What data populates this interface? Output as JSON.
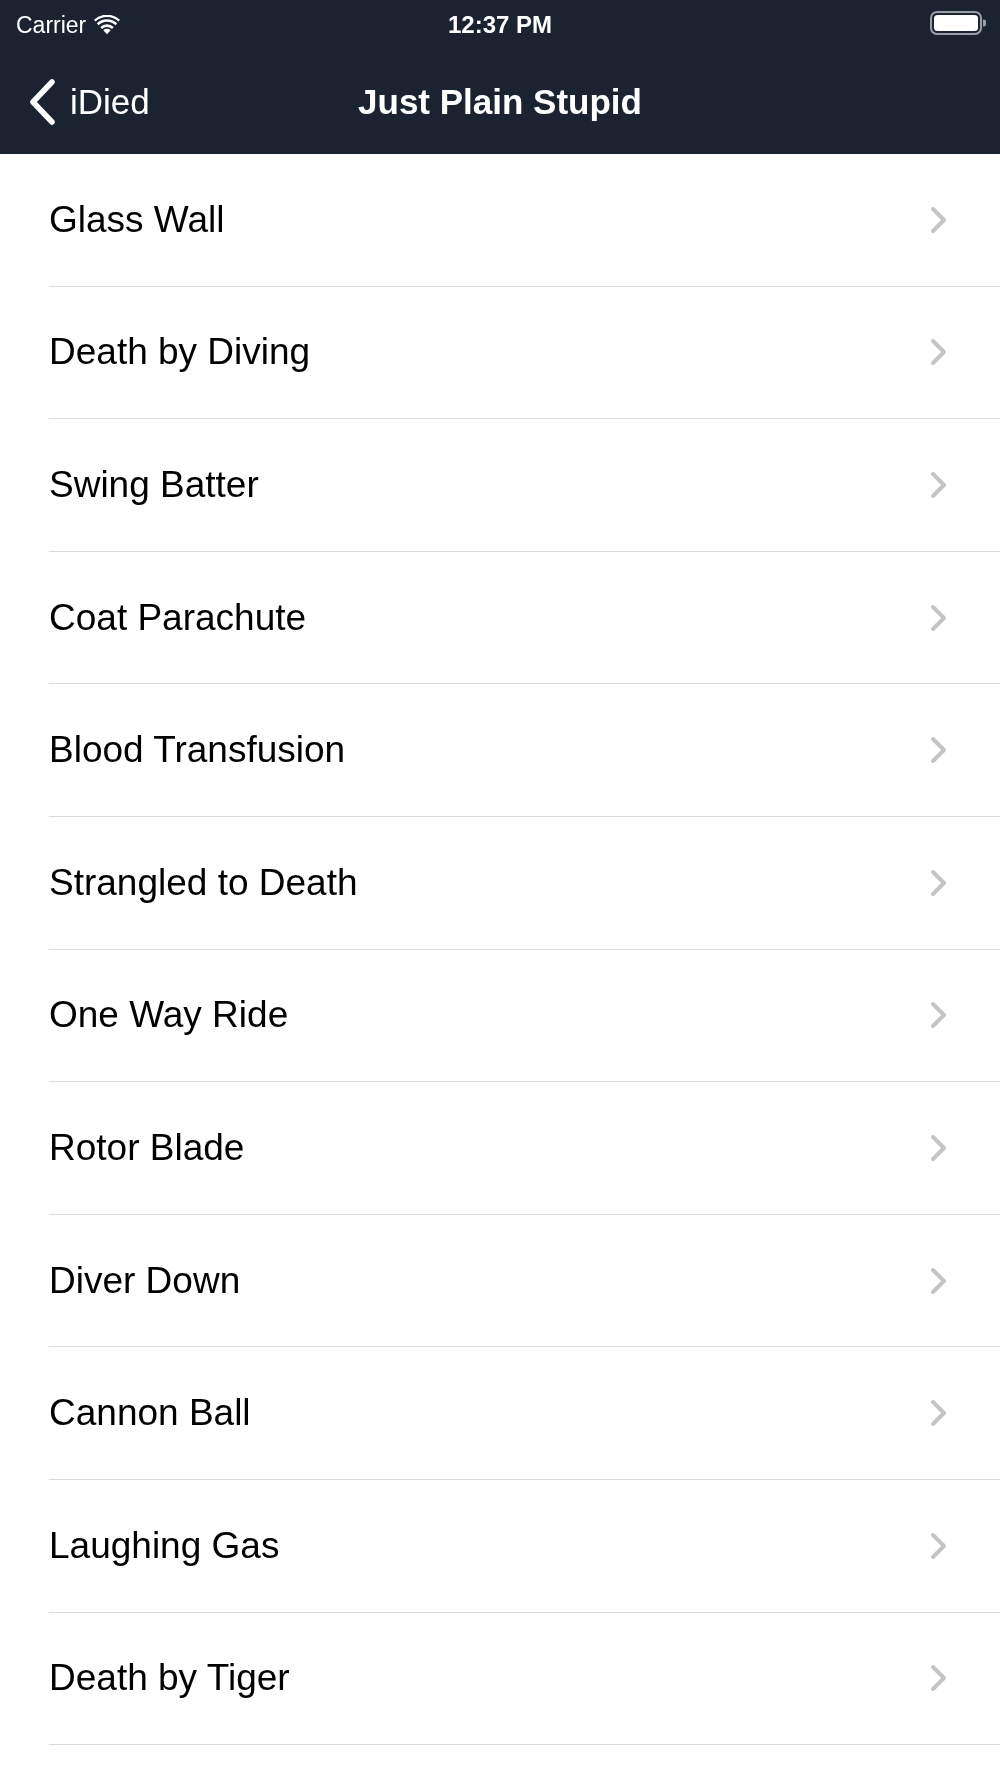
{
  "status_bar": {
    "carrier": "Carrier",
    "time": "12:37 PM"
  },
  "nav_bar": {
    "back_label": "iDied",
    "title": "Just Plain Stupid"
  },
  "items": [
    {
      "label": "Glass Wall"
    },
    {
      "label": "Death by Diving"
    },
    {
      "label": "Swing Batter"
    },
    {
      "label": "Coat Parachute"
    },
    {
      "label": "Blood Transfusion"
    },
    {
      "label": "Strangled to Death"
    },
    {
      "label": "One Way Ride"
    },
    {
      "label": "Rotor Blade"
    },
    {
      "label": "Diver Down"
    },
    {
      "label": "Cannon Ball"
    },
    {
      "label": "Laughing Gas"
    },
    {
      "label": "Death by Tiger"
    }
  ]
}
